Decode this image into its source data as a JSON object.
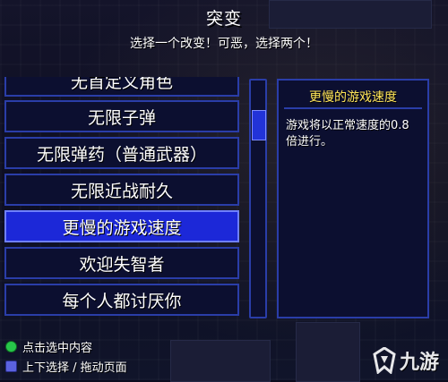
{
  "screen": {
    "title": "突变",
    "subtitle": "选择一个改变！可恶，选择两个！"
  },
  "mutations": [
    {
      "label": "无首定义角色",
      "selected": false
    },
    {
      "label": "无限子弹",
      "selected": false
    },
    {
      "label": "无限弹药（普通武器）",
      "selected": false
    },
    {
      "label": "无限近战耐久",
      "selected": false
    },
    {
      "label": "更慢的游戏速度",
      "selected": true
    },
    {
      "label": "欢迎失智者",
      "selected": false
    },
    {
      "label": "每个人都讨厌你",
      "selected": false
    }
  ],
  "description": {
    "title": "更慢的游戏速度",
    "body": "游戏将以正常速度的0.8倍进行。"
  },
  "hints": [
    {
      "icon": "green-button-icon",
      "text": "点击选中内容"
    },
    {
      "icon": "blue-button-icon",
      "text": "上下选择 / 拖动页面"
    }
  ],
  "watermark": {
    "text": "九游"
  },
  "colors": {
    "panel_bg": "#0c0f30",
    "panel_border": "#2a3da8",
    "selected_bg": "#1c28d8",
    "description_title": "#ffe55a"
  }
}
